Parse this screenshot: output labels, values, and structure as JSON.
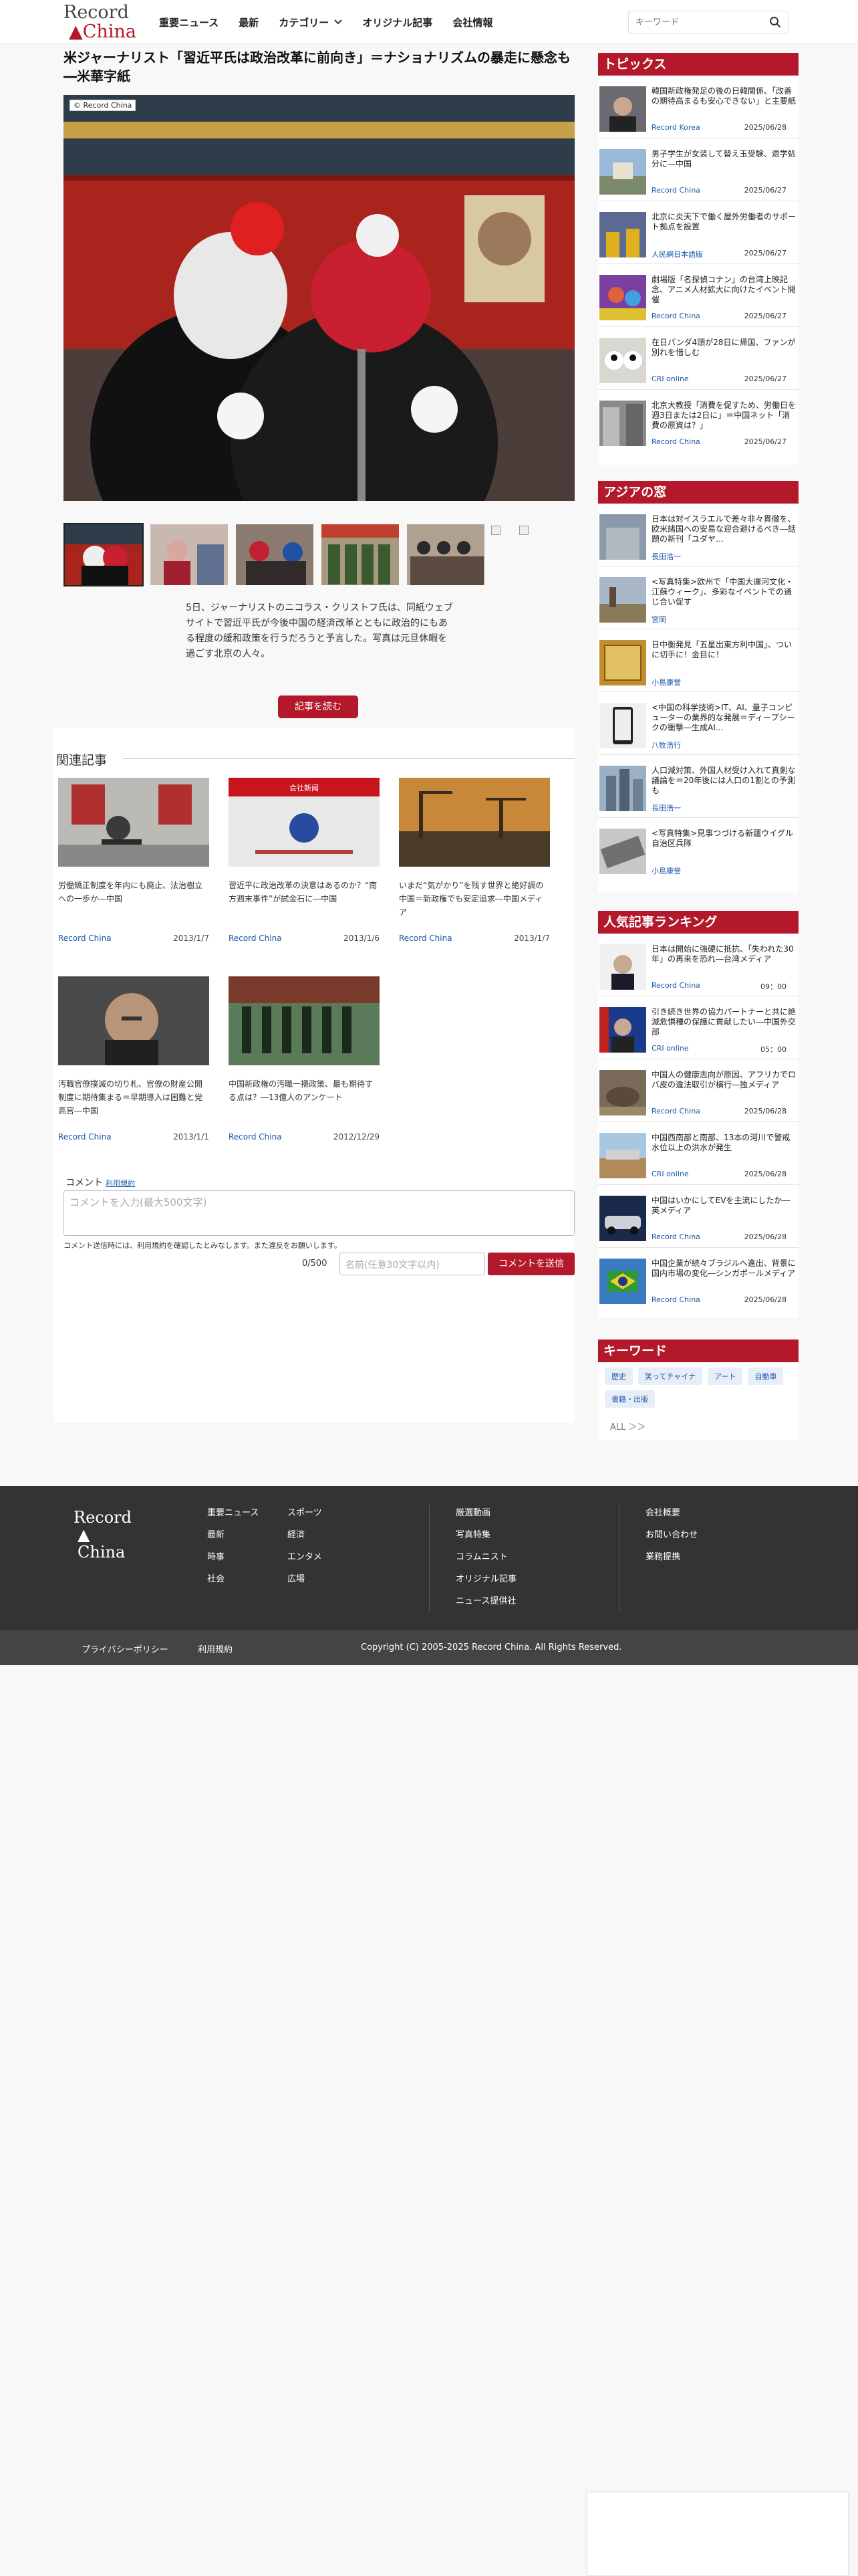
{
  "header": {
    "logo_line1": "Record",
    "logo_line2": "China",
    "nav": [
      "重要ニュース",
      "最新",
      "カテゴリー",
      "オリジナル記事",
      "会社情報"
    ],
    "search_placeholder": "キーワード"
  },
  "article": {
    "title": "米ジャーナリスト「習近平氏は政治改革に前向き」＝ナショナリズムの暴走に懸念も―米華字紙",
    "photo_credit": "© Record China",
    "caption": "5日、ジャーナリストのニコラス・クリストフ氏は、同紙ウェブサイトで習近平氏が今後中国の経済改革とともに政治的にもある程度の緩和政策を行うだろうと予言した。写真は元旦休暇を過ごす北京の人々。",
    "read_button": "記事を読む"
  },
  "related": {
    "heading": "関連記事",
    "items": [
      {
        "title": "労働矯正制度を年内にも廃止、法治樹立への一歩か―中国",
        "source": "Record China",
        "date": "2013/1/7"
      },
      {
        "title": "習近平に政治改革の決意はあるのか？“南方週末事件”が試金石に―中国",
        "source": "Record China",
        "date": "2013/1/6"
      },
      {
        "title": "いまだ“気がかり”を残す世界と絶好調の中国＝新政権でも安定追求―中国メディア",
        "source": "Record China",
        "date": "2013/1/7"
      },
      {
        "title": "汚職官僚撲滅の切り札、官僚の財産公開制度に期待集まる＝早期導入は困難と党高官―中国",
        "source": "Record China",
        "date": "2013/1/1"
      },
      {
        "title": "中国新政権の汚職一掃政策、最も期待する点は？―13億人のアンケート",
        "source": "Record China",
        "date": "2012/12/29"
      }
    ],
    "card2_banner": "会社新闻"
  },
  "comment": {
    "label": "コメント",
    "terms_link": "利用規約",
    "placeholder": "コメントを入力(最大500文字)",
    "note": "コメント送信時には、利用規約を確認したとみなします。また違反をお願いします。",
    "count": "0/500",
    "name_placeholder": "名前(任意30文字以内)",
    "send_button": "コメントを送信"
  },
  "sidebar": {
    "topics": {
      "heading": "トピックス",
      "items": [
        {
          "title": "韓国新政権発足の後の日韓関係、「改善の期待高まるも安心できない」と主要紙",
          "source": "Record Korea",
          "date": "2025/06/28"
        },
        {
          "title": "男子学生が女装して替え玉受験、退学処分に―中国",
          "source": "Record China",
          "date": "2025/06/27"
        },
        {
          "title": "北京に炎天下で働く屋外労働者のサポート拠点を設置",
          "source": "人民網日本語版",
          "date": "2025/06/27"
        },
        {
          "title": "劇場版「名探偵コナン」の台湾上映記念、アニメ人材拡大に向けたイベント開催",
          "source": "Record China",
          "date": "2025/06/27"
        },
        {
          "title": "在日パンダ4頭が28日に帰国、ファンが別れを惜しむ",
          "source": "CRI online",
          "date": "2025/06/27"
        },
        {
          "title": "北京大教授「消費を促すため、労働日を週3日または2日に」＝中国ネット「消費の原資は？」",
          "source": "Record China",
          "date": "2025/06/27"
        }
      ]
    },
    "asia": {
      "heading": "アジアの窓",
      "items": [
        {
          "title": "日本は対イスラエルで差々非々貫徹を、欧米諸国への安易な迎合避けるべき―話題の新刊「ユダヤ…",
          "source": "長田浩一"
        },
        {
          "title": "<写真特集>欧州で「中国大運河文化・江蘇ウィーク」、多彩なイベントでの通じ合い促す",
          "source": "宮岡"
        },
        {
          "title": "日中衡発見「五星出東方利中国」、ついに切手に！金目に！",
          "source": "小島康誉"
        },
        {
          "title": "<中国の科学技術>IT、AI、量子コンピューターの業界的な発展＝ディープシークの衝撃―生成AI…",
          "source": "八牧浩行"
        },
        {
          "title": "人口減対策、外国人材受け入れて真剣な議論を＝20年後には人口の1割との予測も",
          "source": "長田浩一"
        },
        {
          "title": "<写真特集>見事つづける新疆ウイグル自治区兵隊",
          "source": "小島康誉"
        }
      ]
    },
    "ranking": {
      "heading": "人気記事ランキング",
      "items": [
        {
          "title": "日本は開始に強硬に抵抗、「失われた30年」の再来を恐れ―台湾メディア",
          "source": "Record China",
          "date": "09：00"
        },
        {
          "title": "引き続き世界の協力パートナーと共に絶滅危惧種の保護に貢献したい―中国外交部",
          "source": "CRI online",
          "date": "05：00"
        },
        {
          "title": "中国人の健康志向が原因、アフリカでロバ皮の違法取引が横行―独メディア",
          "source": "Record China",
          "date": "2025/06/28"
        },
        {
          "title": "中国西南部と南部、13本の河川で警戒水位以上の洪水が発生",
          "source": "CRI online",
          "date": "2025/06/28"
        },
        {
          "title": "中国はいかにしてEVを主流にしたか―英メディア",
          "source": "Record China",
          "date": "2025/06/28"
        },
        {
          "title": "中国企業が続々ブラジルへ進出、背景に国内市場の変化―シンガポールメディア",
          "source": "Record China",
          "date": "2025/06/28"
        }
      ]
    },
    "keywords": {
      "heading": "キーワード",
      "tags": [
        "歴史",
        "笑ってチャイナ",
        "アート",
        "自動車",
        "書籍・出版"
      ],
      "all": "ALL ＞＞"
    }
  },
  "footer": {
    "col1": [
      "重要ニュース",
      "最新",
      "時事",
      "社会"
    ],
    "col2": [
      "スポーツ",
      "経済",
      "エンタメ",
      "広場"
    ],
    "col3": [
      "厳選動画",
      "写真特集",
      "コラムニスト",
      "オリジナル記事",
      "ニュース提供社"
    ],
    "col4": [
      "会社概要",
      "お問い合わせ",
      "業務提携"
    ],
    "bottom_links": [
      "プライバシーポリシー",
      "利用規約"
    ],
    "copyright": "Copyright (C) 2005-2025 Record China. All Rights Reserved."
  }
}
